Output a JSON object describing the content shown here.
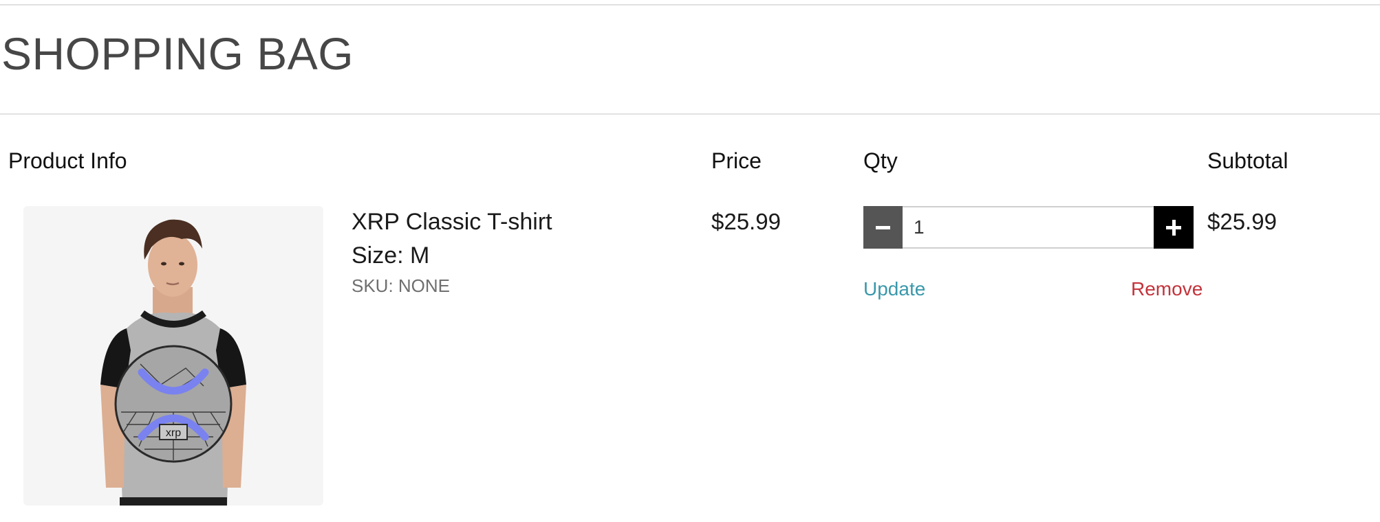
{
  "page": {
    "title": "SHOPPING BAG"
  },
  "columns": {
    "product_info": "Product Info",
    "price": "Price",
    "qty": "Qty",
    "subtotal": "Subtotal"
  },
  "cart_item": {
    "name": "XRP Classic T-shirt",
    "size": "Size: M",
    "sku": "SKU: NONE",
    "price": "$25.99",
    "quantity": "1",
    "subtotal": "$25.99",
    "update_label": "Update",
    "remove_label": "Remove",
    "print_text": "xrp",
    "icons": {
      "decrease": "minus-icon",
      "increase": "plus-icon"
    }
  },
  "colors": {
    "title_text": "#474747",
    "update_link": "#3a98ab",
    "remove_link": "#c4333b",
    "minus_button": "#555555",
    "plus_button": "#000000",
    "divider": "#e1e1e1"
  }
}
